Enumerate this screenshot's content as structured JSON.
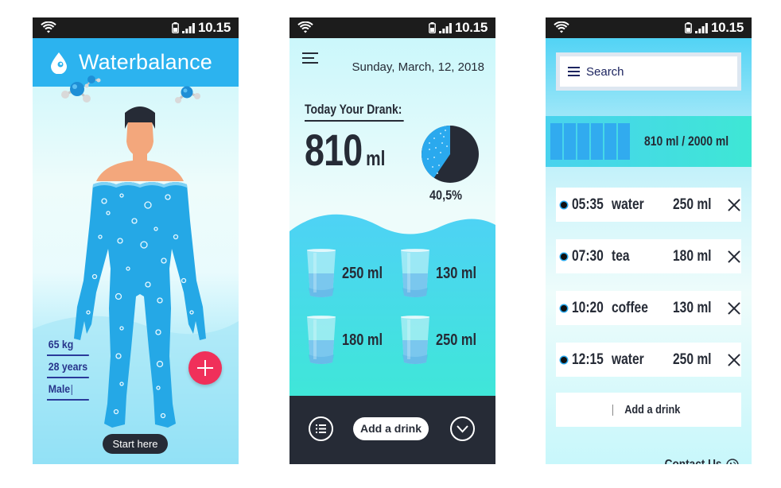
{
  "status_bar": {
    "time": "10.15",
    "icons": [
      "wifi-icon",
      "battery-icon",
      "signal-icon"
    ]
  },
  "screen1": {
    "app_title": "Waterbalance",
    "logo_icon": "water-drop-icon",
    "profile": {
      "weight": "65 kg",
      "age": "28 years",
      "gender": "Male"
    },
    "add_button_icon": "plus-icon",
    "start_button": "Start here"
  },
  "screen2": {
    "date": "Sunday, March, 12, 2018",
    "today_label": "Today Your Drank:",
    "amount_value": "810",
    "amount_unit": "ml",
    "percent_label": "40,5%",
    "percent_value": 40.5,
    "drinks": [
      {
        "label": "250 ml",
        "fill": 0.6
      },
      {
        "label": "130 ml",
        "fill": 0.6
      },
      {
        "label": "180 ml",
        "fill": 0.6
      },
      {
        "label": "250 ml",
        "fill": 0.6
      }
    ],
    "bottom_bar": {
      "list_icon": "list-icon",
      "add_drink": "Add a drink",
      "expand_icon": "chevron-down-icon"
    }
  },
  "screen3": {
    "search_placeholder": "Search",
    "progress_text": "810 ml / 2000 ml",
    "progress_fraction": 0.405,
    "log": [
      {
        "time": "05:35",
        "drink": "water",
        "amount": "250 ml"
      },
      {
        "time": "07:30",
        "drink": "tea",
        "amount": "180 ml"
      },
      {
        "time": "10:20",
        "drink": "coffee",
        "amount": "130 ml"
      },
      {
        "time": "12:15",
        "drink": "water",
        "amount": "250 ml"
      }
    ],
    "add_drink": "Add a drink",
    "contact": "Contact Us"
  },
  "colors": {
    "header_blue": "#2cb3ef",
    "accent_red": "#f0305a",
    "dark": "#262b36",
    "teal": "#3ee7d5",
    "water_blue": "#31abef"
  }
}
